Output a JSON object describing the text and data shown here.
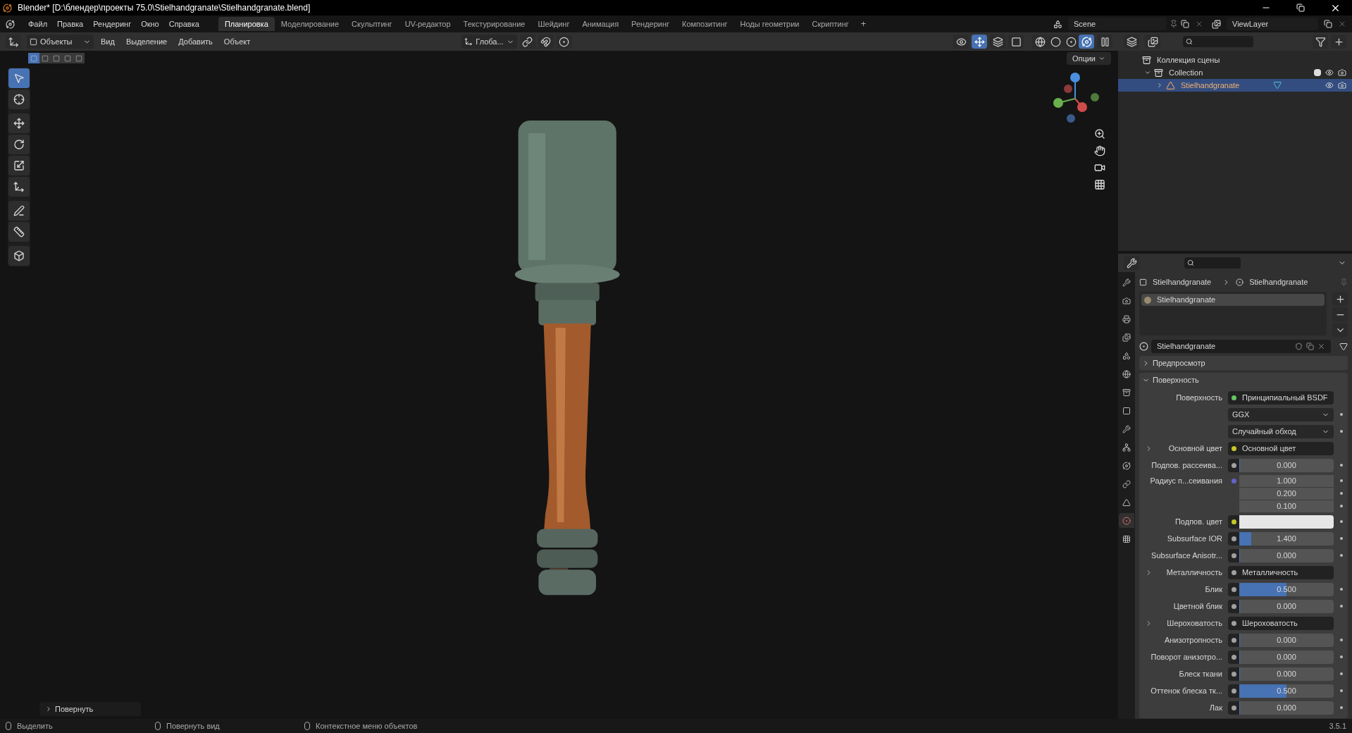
{
  "window": {
    "title": "Blender* [D:\\блендер\\проекты 75.0\\Stielhandgranate\\Stielhandgranate.blend]"
  },
  "menus": [
    "Файл",
    "Правка",
    "Рендеринг",
    "Окно",
    "Справка"
  ],
  "workspaces": [
    {
      "label": "Планировка",
      "selected": true
    },
    {
      "label": "Моделирование",
      "selected": false
    },
    {
      "label": "Скульптинг",
      "selected": false
    },
    {
      "label": "UV-редактор",
      "selected": false
    },
    {
      "label": "Текстурирование",
      "selected": false
    },
    {
      "label": "Шейдинг",
      "selected": false
    },
    {
      "label": "Анимация",
      "selected": false
    },
    {
      "label": "Рендеринг",
      "selected": false
    },
    {
      "label": "Композитинг",
      "selected": false
    },
    {
      "label": "Ноды геометрии",
      "selected": false
    },
    {
      "label": "Скриптинг",
      "selected": false
    }
  ],
  "add_workspace": "+",
  "scene": "Scene",
  "view_layer": "ViewLayer",
  "viewport": {
    "mode": "Объекты",
    "menus": [
      "Вид",
      "Выделение",
      "Добавить",
      "Объект"
    ],
    "orientation": "Глоба...",
    "gizmos_on": true,
    "shading": [
      {
        "kind": "wire",
        "selected": false
      },
      {
        "kind": "solid",
        "selected": false
      },
      {
        "kind": "material",
        "selected": false
      },
      {
        "kind": "rendered",
        "selected": true
      }
    ],
    "select_modes": [
      {
        "selected": true
      },
      {
        "selected": false
      },
      {
        "selected": false
      },
      {
        "selected": false
      },
      {
        "selected": false
      }
    ],
    "options": "Опции",
    "tools": [
      {
        "kind": "select",
        "selected": true
      },
      {
        "kind": "cursor",
        "selected": false
      },
      {
        "kind": "move",
        "selected": false
      },
      {
        "kind": "rotate",
        "selected": false
      },
      {
        "kind": "scale",
        "selected": false
      },
      {
        "kind": "transform",
        "selected": false
      },
      {
        "kind": "annotate",
        "selected": false
      },
      {
        "kind": "measure",
        "selected": false
      },
      {
        "kind": "add-cube",
        "selected": false
      }
    ],
    "last_operator": "Повернуть"
  },
  "outliner": {
    "tree": [
      {
        "label": "Коллекция сцены",
        "kind": "scene",
        "selected": false,
        "children": [
          {
            "label": "Collection",
            "kind": "collection",
            "selected": false,
            "expanded": true,
            "checked": true,
            "children": [
              {
                "label": "Stielhandgranate",
                "kind": "object",
                "selected": true,
                "expanded": false
              }
            ]
          }
        ]
      }
    ]
  },
  "properties": {
    "tabs": [
      {
        "kind": "tool",
        "selected": false
      },
      {
        "kind": "render",
        "selected": false
      },
      {
        "kind": "output",
        "selected": false
      },
      {
        "kind": "view-layer",
        "selected": false
      },
      {
        "kind": "scene",
        "selected": false
      },
      {
        "kind": "world",
        "selected": false
      },
      {
        "kind": "collection",
        "selected": false
      },
      {
        "kind": "object",
        "selected": false
      },
      {
        "kind": "modifiers",
        "selected": false
      },
      {
        "kind": "particles",
        "selected": false
      },
      {
        "kind": "physics",
        "selected": false
      },
      {
        "kind": "constraints",
        "selected": false
      },
      {
        "kind": "data",
        "selected": false
      },
      {
        "kind": "material",
        "selected": true
      },
      {
        "kind": "texture",
        "selected": false
      }
    ],
    "breadcrumb": [
      "Stielhandgranate",
      "Stielhandgranate"
    ],
    "slots": [
      {
        "label": "Stielhandgranate",
        "selected": true
      }
    ],
    "material": "Stielhandgranate",
    "panels": [
      {
        "label": "Предпросмотр",
        "expanded": false
      },
      {
        "label": "Поверхность",
        "expanded": true
      }
    ],
    "rows": [
      {
        "kind": "socket",
        "label": "Поверхность",
        "value": "Принципиальный BSDF",
        "color": "#63c763"
      },
      {
        "kind": "dropdown",
        "value": "GGX"
      },
      {
        "kind": "dropdown",
        "value": "Случайный обход"
      },
      {
        "kind": "socket",
        "label": "Основной цвет",
        "value": "Основной цвет",
        "color": "#c7c729",
        "expandable": true
      },
      {
        "kind": "number",
        "label": "Подпов. рассеива...",
        "value": "0.000",
        "level": 0,
        "color": "#a1a1a1"
      },
      {
        "kind": "vector",
        "label": "Радиус п...сеивания",
        "values": [
          "1.000",
          "0.200",
          "0.100"
        ],
        "color": "#6363c7"
      },
      {
        "kind": "color",
        "label": "Подпов. цвет",
        "color": "#c7c729"
      },
      {
        "kind": "number",
        "label": "Subsurface IOR",
        "value": "1.400",
        "level": 0.13,
        "color": "#a1a1a1"
      },
      {
        "kind": "number",
        "label": "Subsurface Anisotr...",
        "value": "0.000",
        "level": 0,
        "color": "#a1a1a1"
      },
      {
        "kind": "socket",
        "label": "Металличность",
        "value": "Металличность",
        "color": "#a1a1a1",
        "expandable": true
      },
      {
        "kind": "number",
        "label": "Блик",
        "value": "0.500",
        "level": 0.5,
        "color": "#a1a1a1"
      },
      {
        "kind": "number",
        "label": "Цветной блик",
        "value": "0.000",
        "level": 0,
        "color": "#a1a1a1"
      },
      {
        "kind": "socket",
        "label": "Шероховатость",
        "value": "Шероховатость",
        "color": "#a1a1a1",
        "expandable": true
      },
      {
        "kind": "number",
        "label": "Анизотропность",
        "value": "0.000",
        "level": 0,
        "color": "#a1a1a1"
      },
      {
        "kind": "number",
        "label": "Поворот анизотро...",
        "value": "0.000",
        "level": 0,
        "color": "#a1a1a1"
      },
      {
        "kind": "number",
        "label": "Блеск ткани",
        "value": "0.000",
        "level": 0,
        "color": "#a1a1a1"
      },
      {
        "kind": "number",
        "label": "Оттенок блеска тк...",
        "value": "0.500",
        "level": 0.5,
        "color": "#a1a1a1"
      },
      {
        "kind": "number",
        "label": "Лак",
        "value": "0.000",
        "level": 0,
        "color": "#a1a1a1"
      }
    ]
  },
  "status_bar": {
    "hints": [
      "Выделить",
      "Повернуть вид",
      "Контекстное меню объектов"
    ],
    "version": "3.5.1"
  }
}
